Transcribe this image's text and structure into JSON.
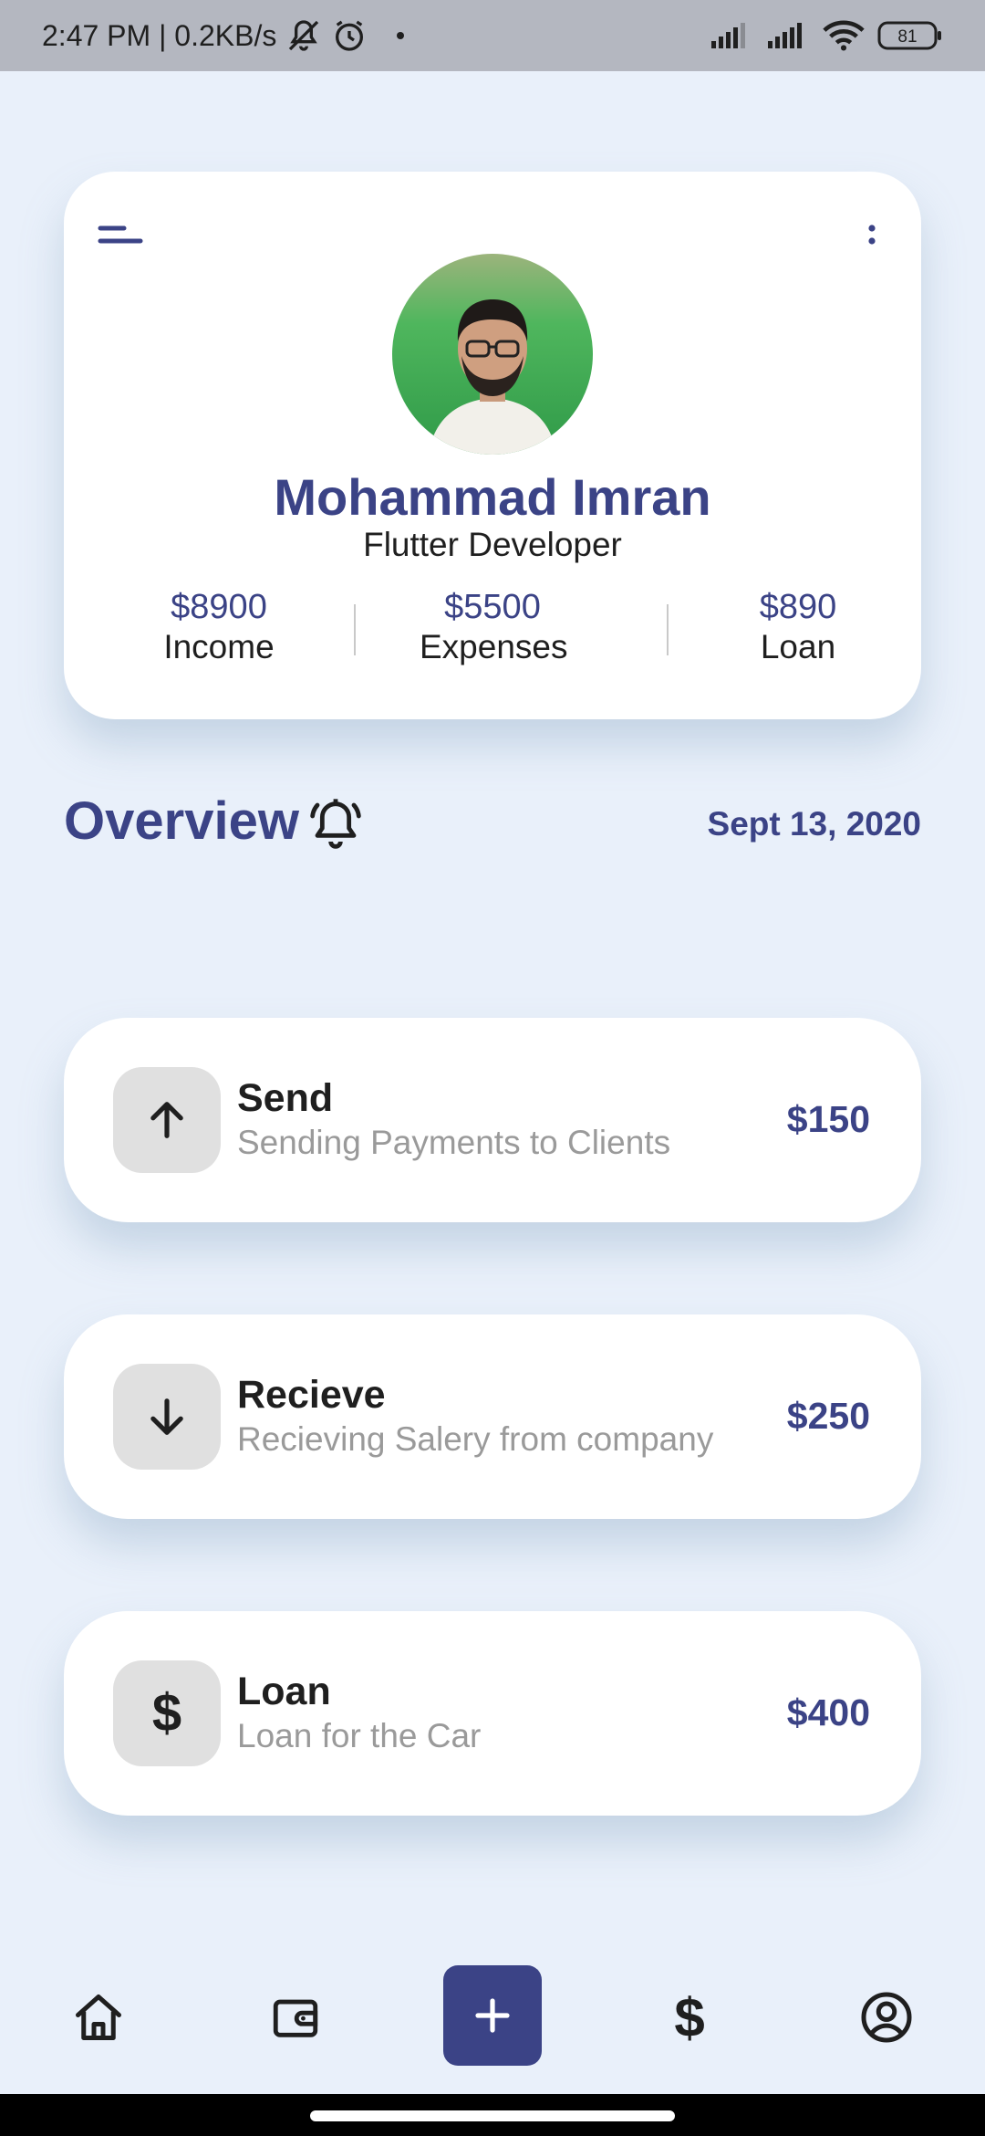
{
  "status_bar": {
    "text": "2:47 PM | 0.2KB/s",
    "battery": "81",
    "icons": [
      "mute-icon",
      "alarm-icon",
      "signal-icon",
      "signal-icon",
      "wifi-icon",
      "battery-icon"
    ]
  },
  "profile": {
    "name": "Mohammad Imran",
    "role": "Flutter Developer",
    "stats": [
      {
        "value": "$8900",
        "label": "Income"
      },
      {
        "value": "$5500",
        "label": "Expenses"
      },
      {
        "value": "$890",
        "label": "Loan"
      }
    ]
  },
  "overview": {
    "title": "Overview",
    "date": "Sept 13, 2020"
  },
  "transactions": [
    {
      "title": "Send",
      "subtitle": "Sending Payments to Clients",
      "amount": "$150",
      "icon": "arrow-up-icon"
    },
    {
      "title": "Recieve",
      "subtitle": "Recieving Salery from company",
      "amount": "$250",
      "icon": "arrow-down-icon"
    },
    {
      "title": "Loan",
      "subtitle": "Loan for the Car",
      "amount": "$400",
      "icon": "dollar-icon",
      "glyph": "$"
    }
  ],
  "bottom_nav": {
    "items": [
      "home-icon",
      "wallet-icon",
      "add-icon",
      "dollar-icon",
      "account-icon"
    ],
    "dollar_glyph": "$"
  },
  "colors": {
    "accent": "#3b4386",
    "background": "#e9f0fa",
    "card": "#ffffff",
    "subtitle": "#9a9a9a"
  }
}
